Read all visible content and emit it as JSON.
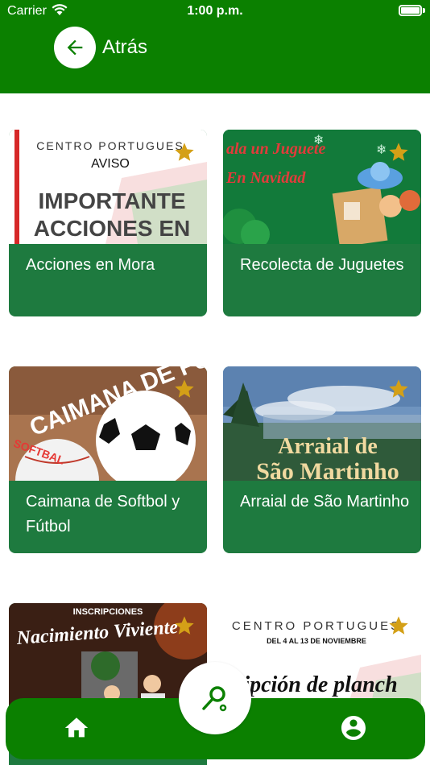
{
  "status_bar": {
    "carrier": "Carrier",
    "time": "1:00 p.m."
  },
  "header": {
    "back_label": "Atrás"
  },
  "colors": {
    "brand_green": "#0b8000",
    "card_green": "#1e7a3f",
    "star_gold": "#d4a017"
  },
  "cards": [
    {
      "title": "Acciones en Mora",
      "image_text_top": "CENTRO PORTUGUES",
      "image_text_mid": "AVISO",
      "image_text_main": "IMPORTANTE ACCIONES EN"
    },
    {
      "title": "Recolecta de Juguetes",
      "image_text": "ala un Juguete En Navidad"
    },
    {
      "title": "Caimana de Softbol y Fútbol",
      "image_text": "CAIMANA DE FUTBOL",
      "image_text_small": "SOFTBAL"
    },
    {
      "title": "Arraial de São Martinho",
      "image_text": "Arraial de São Martinho"
    },
    {
      "title": "",
      "image_text_top": "INSCRIPCIONES",
      "image_text": "Nacimiento Viviente"
    },
    {
      "title": "",
      "image_text_top": "CENTRO PORTUGUES",
      "image_text_mid": "DEL 4 AL 13 DE NOVIEMBRE",
      "image_text": "cripción de planch"
    }
  ],
  "bottom_nav": {
    "home_icon": "home-icon",
    "search_icon": "search-icon",
    "profile_icon": "account-circle-icon"
  }
}
